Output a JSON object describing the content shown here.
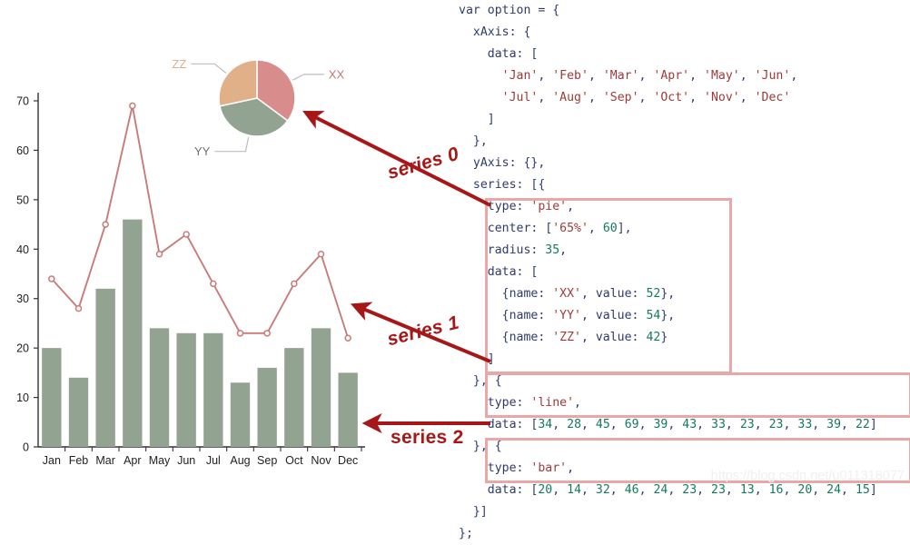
{
  "chart_data": [
    {
      "type": "bar",
      "name": "series 2",
      "categories": [
        "Jan",
        "Feb",
        "Mar",
        "Apr",
        "May",
        "Jun",
        "Jul",
        "Aug",
        "Sep",
        "Oct",
        "Nov",
        "Dec"
      ],
      "values": [
        20,
        14,
        32,
        46,
        24,
        23,
        23,
        13,
        16,
        20,
        24,
        15
      ],
      "title": "",
      "xlabel": "",
      "ylabel": "",
      "ylim": [
        0,
        70
      ],
      "yticks": [
        0,
        10,
        20,
        30,
        40,
        50,
        60,
        70
      ],
      "grid": false,
      "legend": "none",
      "color": "#93a391"
    },
    {
      "type": "line",
      "name": "series 1",
      "categories": [
        "Jan",
        "Feb",
        "Mar",
        "Apr",
        "May",
        "Jun",
        "Jul",
        "Aug",
        "Sep",
        "Oct",
        "Nov",
        "Dec"
      ],
      "values": [
        34,
        28,
        45,
        69,
        39,
        43,
        33,
        23,
        23,
        33,
        39,
        22
      ],
      "title": "",
      "xlabel": "",
      "ylabel": "",
      "ylim": [
        0,
        70
      ],
      "grid": false,
      "legend": "none",
      "color": "#c97b7b"
    },
    {
      "type": "pie",
      "name": "series 0",
      "categories": [
        "XX",
        "YY",
        "ZZ"
      ],
      "values": [
        52,
        54,
        42
      ],
      "title": "",
      "legend": "outside-labels",
      "colors": [
        "#d98c8c",
        "#93a391",
        "#e0b088"
      ]
    }
  ],
  "chart": {
    "y_axis": {
      "ticks": [
        "0",
        "10",
        "20",
        "30",
        "40",
        "50",
        "60",
        "70"
      ]
    },
    "x_axis": {
      "ticks": [
        "Jan",
        "Feb",
        "Mar",
        "Apr",
        "May",
        "Jun",
        "Jul",
        "Aug",
        "Sep",
        "Oct",
        "Nov",
        "Dec"
      ]
    },
    "pie_labels": [
      {
        "text": "XX",
        "color": "#c07a7a"
      },
      {
        "text": "YY",
        "color": "#6f6f6f"
      },
      {
        "text": "ZZ",
        "color": "#d9b08c"
      }
    ]
  },
  "annotations": {
    "series_0": "series 0",
    "series_1": "series 1",
    "series_2": "series 2"
  },
  "code": {
    "lines": [
      "var option = {",
      "  xAxis: {",
      "    data: [",
      "      'Jan', 'Feb', 'Mar', 'Apr', 'May', 'Jun',",
      "      'Jul', 'Aug', 'Sep', 'Oct', 'Nov', 'Dec'",
      "    ]",
      "  },",
      "  yAxis: {},",
      "  series: [{",
      "    type: 'pie',",
      "    center: ['65%', 60],",
      "    radius: 35,",
      "    data: [",
      "      {name: 'XX', value: 52},",
      "      {name: 'YY', value: 54},",
      "      {name: 'ZZ', value: 42}",
      "    ]",
      "  }, {",
      "    type: 'line',",
      "    data: [34, 28, 45, 69, 39, 43, 33, 23, 23, 33, 39, 22]",
      "  }, {",
      "    type: 'bar',",
      "    data: [20, 14, 32, 46, 24, 23, 23, 13, 16, 20, 24, 15]",
      "  }]",
      "};"
    ]
  },
  "watermark": "https://blog.csdn.net/u011318077"
}
